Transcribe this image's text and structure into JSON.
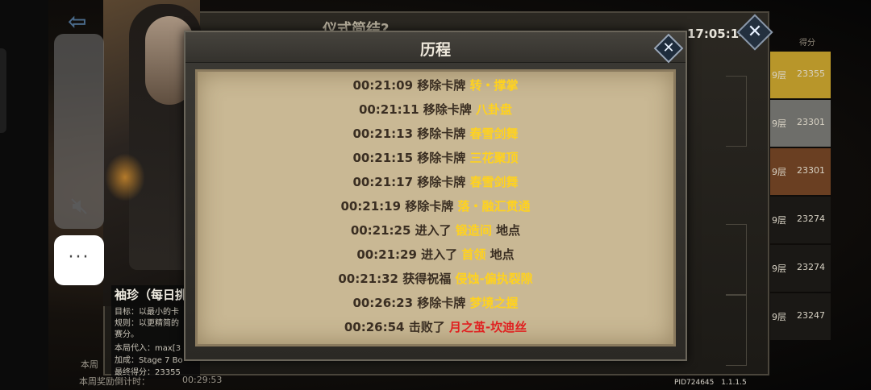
{
  "background": {
    "window_title": "仪式简结?",
    "clock": "17:05:14",
    "character": {
      "name": "袖珍（每日挑",
      "lines": [
        "目标：以最小的卡",
        "规则：以更精简的",
        "赛分。",
        "本局代入：max[3",
        "加成：Stage 7 Bo",
        "最终得分：23355"
      ]
    },
    "bottom": {
      "week_label": "本周",
      "reward_label": "本周奖励倒计时：",
      "countdown": "00:29:53"
    },
    "ranking": {
      "header_score": "得分",
      "rows": [
        {
          "floor": "9层",
          "score": "23355",
          "color": "#b8962a"
        },
        {
          "floor": "9层",
          "score": "23301",
          "color": "#6e6e6a"
        },
        {
          "floor": "9层",
          "score": "23301",
          "color": "#6a3f22"
        },
        {
          "floor": "9层",
          "score": "23274",
          "color": "#1a1815"
        },
        {
          "floor": "9层",
          "score": "23274",
          "color": "#1a1815"
        },
        {
          "floor": "9层",
          "score": "23247",
          "color": "#1a1815"
        }
      ]
    },
    "pid": "PID724645",
    "version": "1.1.1.5"
  },
  "overlay": {
    "more_label": "···"
  },
  "modal": {
    "title": "历程",
    "close_label": "✕",
    "log": [
      {
        "time": "00:21:09",
        "action": "移除卡牌",
        "target": "转・撑掌",
        "suffix": "",
        "color": "yellow"
      },
      {
        "time": "00:21:11",
        "action": "移除卡牌",
        "target": "八卦盘",
        "suffix": "",
        "color": "yellow"
      },
      {
        "time": "00:21:13",
        "action": "移除卡牌",
        "target": "春雪剑舞",
        "suffix": "",
        "color": "yellow"
      },
      {
        "time": "00:21:15",
        "action": "移除卡牌",
        "target": "三花聚顶",
        "suffix": "",
        "color": "yellow"
      },
      {
        "time": "00:21:17",
        "action": "移除卡牌",
        "target": "春雪剑舞",
        "suffix": "",
        "color": "yellow"
      },
      {
        "time": "00:21:19",
        "action": "移除卡牌",
        "target": "落・融汇贯通",
        "suffix": "",
        "color": "yellow"
      },
      {
        "time": "00:21:25",
        "action": "进入了",
        "target": "锻造间",
        "suffix": "地点",
        "color": "yellow"
      },
      {
        "time": "00:21:29",
        "action": "进入了",
        "target": "首领",
        "suffix": "地点",
        "color": "yellow"
      },
      {
        "time": "00:21:32",
        "action": "获得祝福",
        "target": "侵蚀-偏执裂隙",
        "suffix": "",
        "color": "yellow"
      },
      {
        "time": "00:26:23",
        "action": "移除卡牌",
        "target": "梦境之握",
        "suffix": "",
        "color": "yellow"
      },
      {
        "time": "00:26:54",
        "action": "击败了",
        "target": "月之茧-坎迪丝",
        "suffix": "",
        "color": "red"
      }
    ]
  }
}
